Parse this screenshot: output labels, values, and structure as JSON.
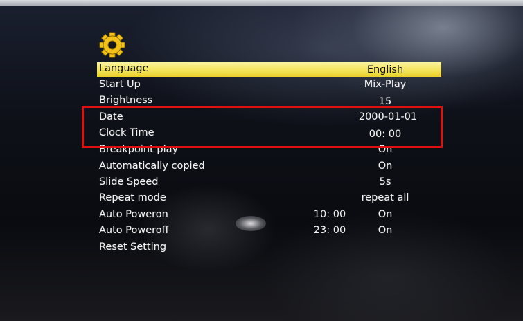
{
  "header": {
    "icon": "gear-icon"
  },
  "menu": {
    "items": [
      {
        "label": "Language",
        "value": "English",
        "time": ""
      },
      {
        "label": "Start Up",
        "value": "Mix-Play",
        "time": ""
      },
      {
        "label": "Brightness",
        "value": "15",
        "time": ""
      },
      {
        "label": "Date",
        "value": "2000-01-01",
        "time": ""
      },
      {
        "label": "Clock Time",
        "value": "00: 00",
        "time": ""
      },
      {
        "label": "Breakpoint play",
        "value": "On",
        "time": ""
      },
      {
        "label": "Automatically copied",
        "value": "On",
        "time": ""
      },
      {
        "label": "Slide Speed",
        "value": "5s",
        "time": ""
      },
      {
        "label": "Repeat mode",
        "value": "repeat all",
        "time": ""
      },
      {
        "label": "Auto Poweron",
        "value": "On",
        "time": "10: 00"
      },
      {
        "label": "Auto Poweroff",
        "value": "On",
        "time": "23: 00"
      },
      {
        "label": "Reset Setting",
        "value": "",
        "time": ""
      }
    ]
  },
  "colors": {
    "highlight": "#f4e45a",
    "annotation_box": "#e01010",
    "gear": "#f2c21a"
  }
}
